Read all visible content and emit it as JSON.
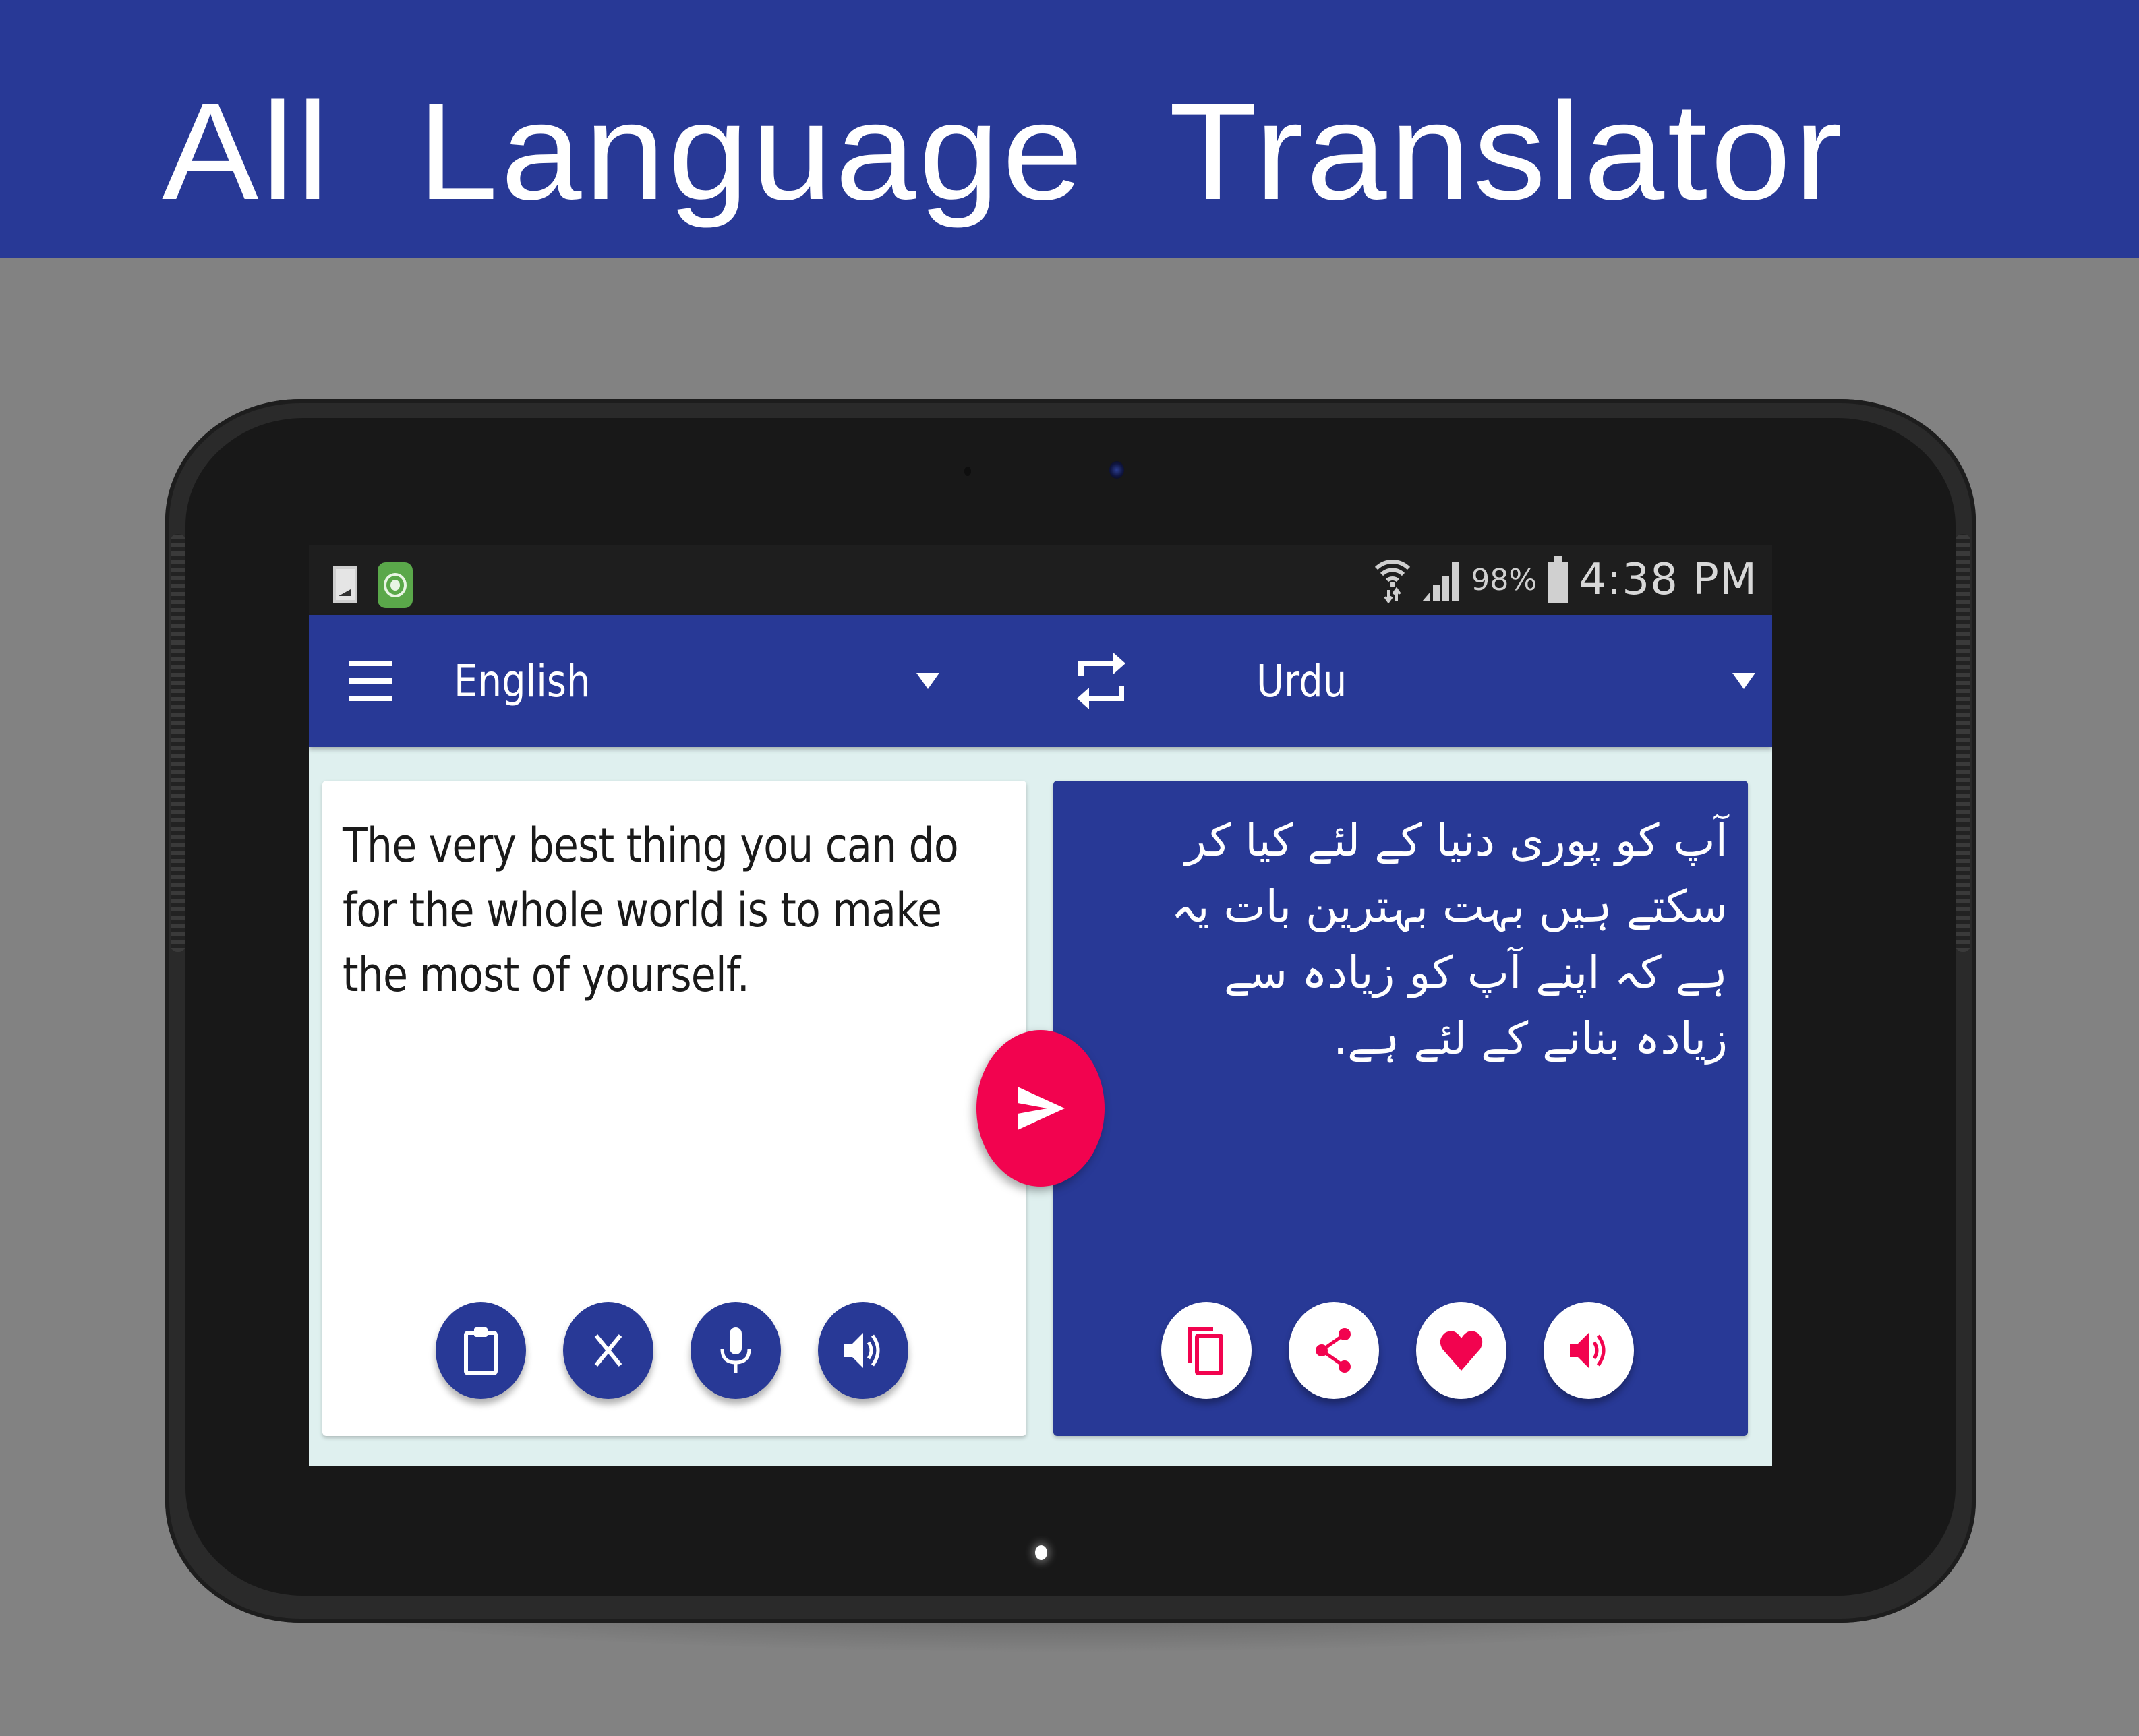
{
  "banner": {
    "title": "All  Language  Translator"
  },
  "colors": {
    "primary": "#283996",
    "accent": "#f2034f",
    "screen_bg": "#dff0ef",
    "status_bar": "#1e1e1e",
    "page_bg": "#828282"
  },
  "status_bar": {
    "left_icons": [
      "gallery-notification-icon",
      "app-notification-icon"
    ],
    "wifi_icon": "wifi-icon",
    "signal_icon": "cellular-signal-icon",
    "battery_percent": "98%",
    "battery_icon": "battery-icon",
    "time": "4:38 PM"
  },
  "toolbar": {
    "menu_icon": "hamburger-menu-icon",
    "source_language": "English",
    "swap_icon": "swap-languages-icon",
    "target_language": "Urdu",
    "dropdown_icon": "dropdown-caret-icon"
  },
  "source_panel": {
    "text": "The very best thing you can do for the whole world is to make the most of yourself.",
    "actions": [
      {
        "name": "paste-button",
        "icon": "clipboard-icon"
      },
      {
        "name": "clear-button",
        "icon": "close-icon"
      },
      {
        "name": "voice-input-button",
        "icon": "microphone-icon"
      },
      {
        "name": "speak-source-button",
        "icon": "speaker-icon"
      }
    ]
  },
  "translate_button": {
    "icon": "send-icon"
  },
  "target_panel": {
    "text": "آپ کو پوری دنیا کے لئے کیا کر سکتے ہیں بہت بہترین بات یہ ہے کہ اپنے آپ کو زیادہ سے زیادہ بنانے کے لئے ہے.",
    "actions": [
      {
        "name": "copy-button",
        "icon": "copy-icon"
      },
      {
        "name": "share-button",
        "icon": "share-icon"
      },
      {
        "name": "favorite-button",
        "icon": "heart-icon"
      },
      {
        "name": "speak-target-button",
        "icon": "speaker-icon"
      }
    ]
  }
}
